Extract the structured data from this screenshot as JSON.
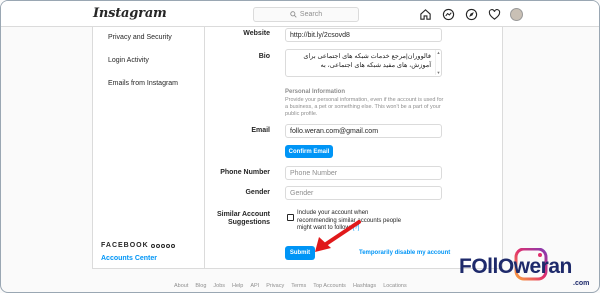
{
  "topnav": {
    "logo": "Instagram",
    "search_placeholder": "Search",
    "icons": [
      "home-icon",
      "messenger-icon",
      "explore-icon",
      "heart-icon",
      "avatar"
    ]
  },
  "sidebar": {
    "items": [
      {
        "label": "Privacy and Security"
      },
      {
        "label": "Login Activity"
      },
      {
        "label": "Emails from Instagram"
      }
    ],
    "facebook_label": "FACEBOOK",
    "accounts_center": "Accounts Center"
  },
  "form": {
    "website_label": "Website",
    "website_value": "http://bit.ly/2csovd8",
    "bio_label": "Bio",
    "bio_value": "فالووران|مرجع خدمات شبکه های اجتماعی برای آموزش، های مفید شبکه های اجتماعی، به",
    "personal_info_title": "Personal Information",
    "personal_info_text": "Provide your personal information, even if the account is used for a business, a pet or something else. This won't be a part of your public profile.",
    "email_label": "Email",
    "email_value": "follo.weran.com@gmail.com",
    "confirm_email": "Confirm Email",
    "phone_label": "Phone Number",
    "phone_placeholder": "Phone Number",
    "gender_label": "Gender",
    "gender_placeholder": "Gender",
    "similar_label_1": "Similar Account",
    "similar_label_2": "Suggestions",
    "similar_text": "Include your account when recommending similar accounts people might want to follow.",
    "similar_q": "[?]",
    "submit": "Submit",
    "disable_link": "Temporarily disable my account"
  },
  "footer": {
    "links": [
      "About",
      "Blog",
      "Jobs",
      "Help",
      "API",
      "Privacy",
      "Terms",
      "Top Accounts",
      "Hashtags",
      "Locations"
    ]
  },
  "watermark": {
    "brand": "FOllOweran",
    "domain": ".com"
  },
  "colors": {
    "accent": "#0095f6",
    "arrow": "#e0191b",
    "brand": "#1e2a6b"
  }
}
